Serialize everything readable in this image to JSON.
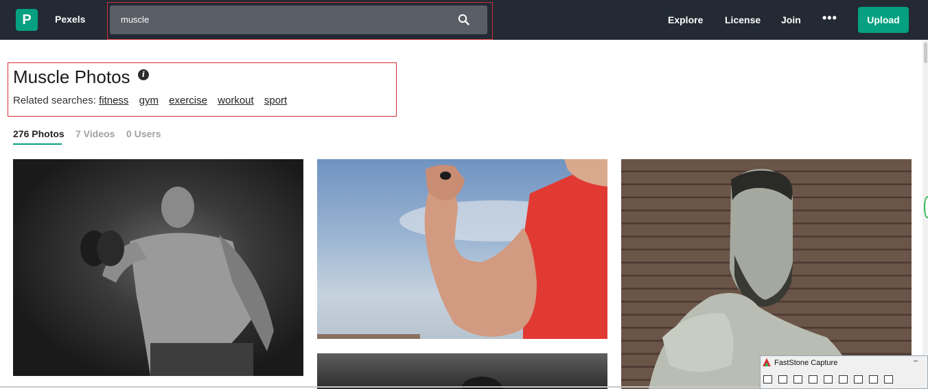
{
  "header": {
    "logo_letter": "P",
    "brand": "Pexels",
    "search": {
      "value": "muscle"
    },
    "nav": [
      "Explore",
      "License",
      "Join"
    ],
    "more": "•••",
    "upload_label": "Upload"
  },
  "main": {
    "title": "Muscle Photos",
    "info_icon_glyph": "i",
    "related_label": "Related searches:",
    "related": [
      "fitness",
      "gym",
      "exercise",
      "workout",
      "sport"
    ],
    "tabs": [
      {
        "label": "276 Photos",
        "active": true
      },
      {
        "label": "7 Videos",
        "active": false
      },
      {
        "label": "0 Users",
        "active": false
      }
    ]
  },
  "photos": [
    {
      "name": "photo-man-dumbbell"
    },
    {
      "name": "photo-bicep-red-shirt"
    },
    {
      "name": "photo-man-bearded"
    },
    {
      "name": "photo-gym-dark"
    }
  ],
  "faststone": {
    "title": "FastStone Capture",
    "minimize": "–"
  },
  "colors": {
    "accent": "#05a081",
    "topbar": "#232a34",
    "highlight": "#d62b36"
  }
}
